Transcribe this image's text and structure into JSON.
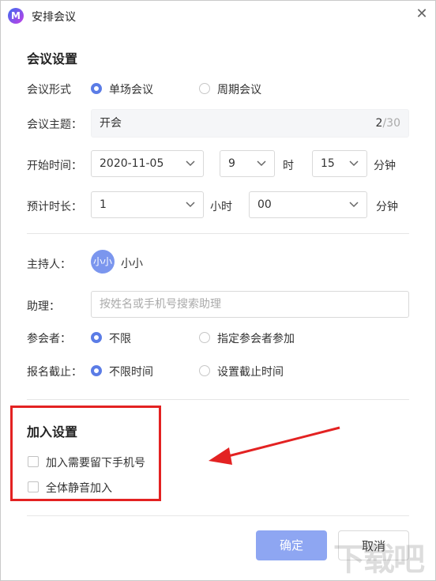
{
  "window": {
    "title": "安排会议",
    "logo_text": "M"
  },
  "meeting_settings": {
    "title": "会议设置",
    "format": {
      "label": "会议形式",
      "options": [
        "单场会议",
        "周期会议"
      ],
      "selected": 0
    },
    "subject": {
      "label": "会议主题：",
      "value": "开会",
      "count": "2",
      "max": "/30"
    },
    "start_time": {
      "label": "开始时间：",
      "date": "2020-11-05",
      "hour": "9",
      "hour_unit": "时",
      "minute": "15",
      "minute_unit": "分钟"
    },
    "duration": {
      "label": "预计时长：",
      "hours": "1",
      "hours_unit": "小时",
      "minutes": "00",
      "minutes_unit": "分钟"
    }
  },
  "people": {
    "host": {
      "label": "主持人：",
      "avatar_text": "小小",
      "name": "小小"
    },
    "assistant": {
      "label": "助理：",
      "placeholder": "按姓名或手机号搜索助理"
    },
    "attendees": {
      "label": "参会者：",
      "options": [
        "不限",
        "指定参会者参加"
      ],
      "selected": 0
    },
    "deadline": {
      "label": "报名截止：",
      "options": [
        "不限时间",
        "设置截止时间"
      ],
      "selected": 0
    }
  },
  "join_settings": {
    "title": "加入设置",
    "options": [
      "加入需要留下手机号",
      "全体静音加入"
    ]
  },
  "buttons": {
    "confirm": "确定",
    "cancel": "取消"
  },
  "watermark": "下载吧",
  "colors": {
    "accent": "#5b7ce6",
    "annotation": "#e32222"
  }
}
